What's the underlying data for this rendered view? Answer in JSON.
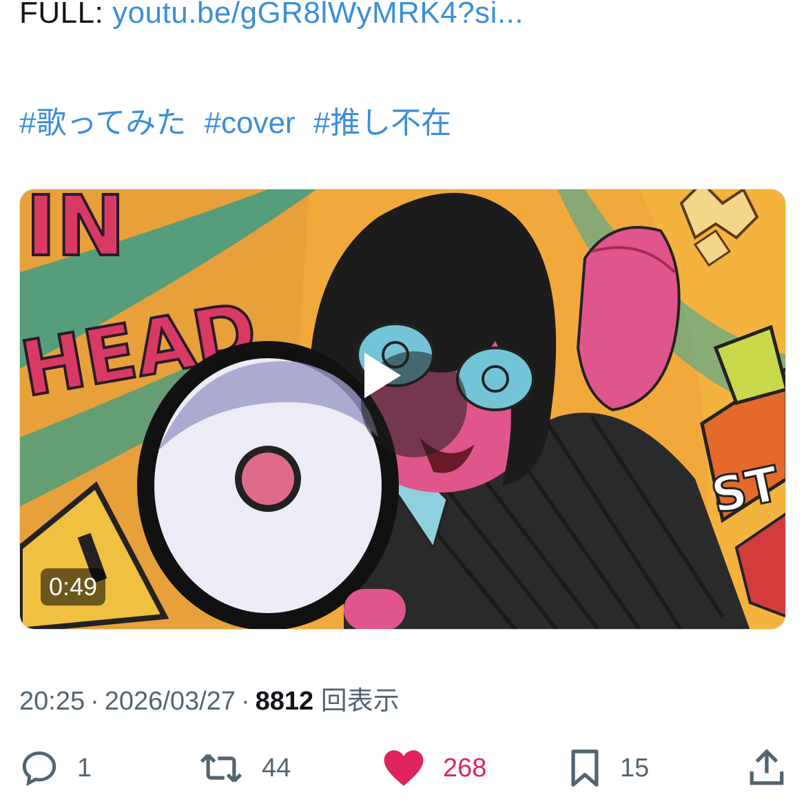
{
  "post": {
    "full_prefix": "FULL:",
    "full_link": "youtu.be/gGR8lWyMRK4?si...",
    "hashtags": [
      "#歌ってみた",
      "#cover",
      "#推し不在"
    ]
  },
  "media": {
    "duration": "0:49",
    "artwork_text": [
      "IN",
      "HEAD"
    ]
  },
  "meta": {
    "time": "20:25",
    "dot": "·",
    "date": "2026/03/27",
    "views_count": "8812",
    "views_label": "回表示"
  },
  "actions": {
    "replies": "1",
    "reposts": "44",
    "likes": "268",
    "bookmarks": "15"
  },
  "colors": {
    "link": "#3b8fd9",
    "like": "#e0245e",
    "muted": "#536471",
    "text": "#0f1419"
  },
  "icons": [
    "reply-icon",
    "repost-icon",
    "heart-icon",
    "bookmark-icon",
    "share-icon",
    "play-icon"
  ]
}
